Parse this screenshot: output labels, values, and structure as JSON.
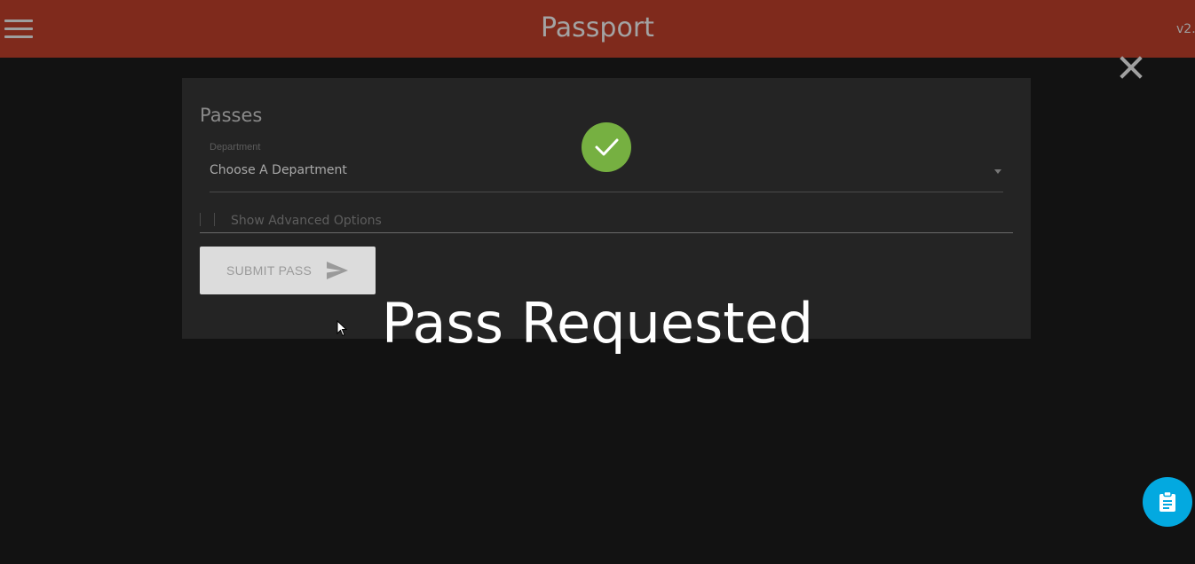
{
  "app": {
    "title": "Passport",
    "version": "v2."
  },
  "card": {
    "title": "Passes",
    "department": {
      "label": "Department",
      "value": "Choose A Department"
    },
    "advanced_label": "Show Advanced Options",
    "submit_label": "SUBMIT PASS"
  },
  "overlay": {
    "message": "Pass Requested"
  },
  "icons": {
    "menu": "menu-icon",
    "close": "close-icon",
    "success": "check-circle-icon",
    "send": "send-icon",
    "clipboard": "clipboard-icon"
  },
  "colors": {
    "appbar": "#7f2a1c",
    "success": "#76b041",
    "fab": "#03a9e0",
    "background": "#121212",
    "card": "#242424"
  }
}
